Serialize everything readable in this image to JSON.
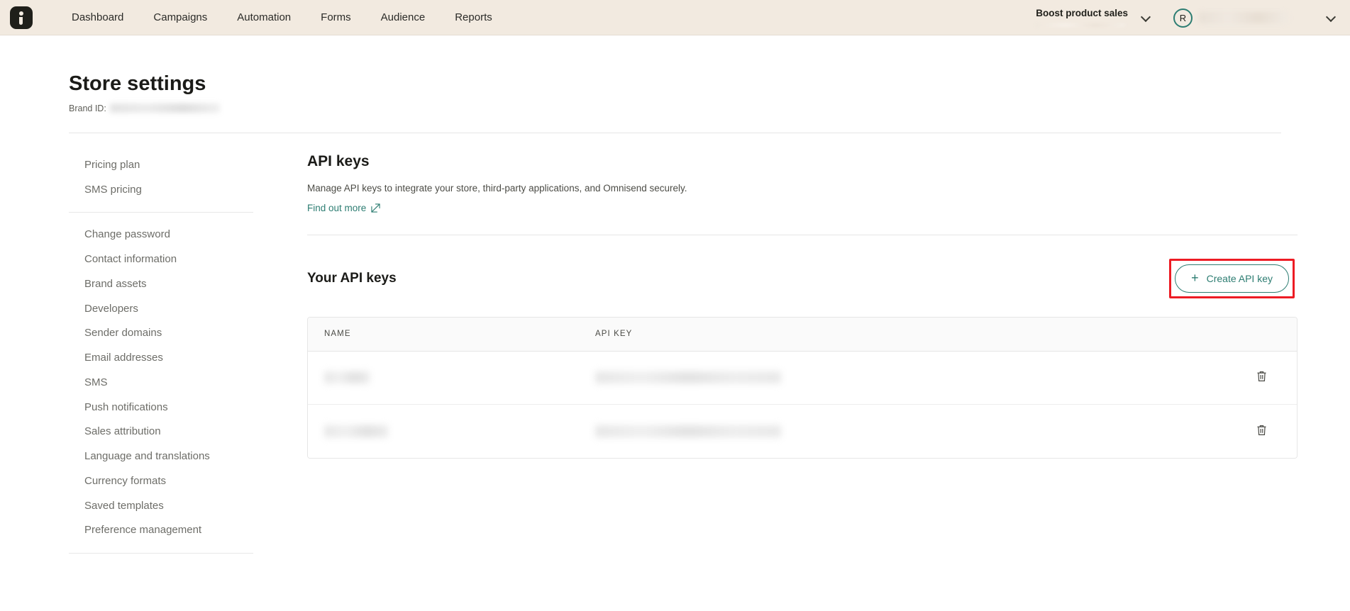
{
  "navbar": {
    "logo_icon": "omnisend-logo-icon",
    "links": [
      {
        "label": "Dashboard"
      },
      {
        "label": "Campaigns"
      },
      {
        "label": "Automation"
      },
      {
        "label": "Forms"
      },
      {
        "label": "Audience"
      },
      {
        "label": "Reports"
      }
    ],
    "boost": {
      "label": "Boost product sales",
      "progress_hidden": true,
      "chevron_icon": "chevron-down-icon"
    },
    "account": {
      "avatar_initial": "R",
      "avatar_ring_color": "#2D7D72",
      "name_hidden": true,
      "chevron_icon": "chevron-down-icon"
    },
    "background_color": "#F2EAE0"
  },
  "page": {
    "title": "Store settings",
    "brand_id_label": "Brand ID:",
    "brand_id_value_hidden": true
  },
  "sidebar": {
    "groups": [
      {
        "items": [
          {
            "label": "Pricing plan"
          },
          {
            "label": "SMS pricing"
          }
        ]
      },
      {
        "items": [
          {
            "label": "Change password"
          },
          {
            "label": "Contact information"
          },
          {
            "label": "Brand assets"
          },
          {
            "label": "Developers"
          },
          {
            "label": "Sender domains"
          },
          {
            "label": "Email addresses"
          },
          {
            "label": "SMS"
          },
          {
            "label": "Push notifications"
          },
          {
            "label": "Sales attribution"
          },
          {
            "label": "Language and translations"
          },
          {
            "label": "Currency formats"
          },
          {
            "label": "Saved templates"
          },
          {
            "label": "Preference management"
          }
        ]
      }
    ]
  },
  "main": {
    "heading": "API keys",
    "description": "Manage API keys to integrate your store, third-party applications, and Omnisend securely.",
    "find_out_more": {
      "label": "Find out more",
      "icon": "external-link-icon",
      "color": "#2D7D72"
    },
    "keys_section": {
      "title": "Your API keys",
      "create_button": {
        "label": "Create API key",
        "icon": "plus-icon",
        "border_color": "#2D7D72",
        "highlight_color": "#ED1C24",
        "highlighted": true
      },
      "table": {
        "columns": [
          {
            "key": "name",
            "label": "NAME"
          },
          {
            "key": "api_key",
            "label": "API KEY"
          },
          {
            "key": "actions",
            "label": ""
          }
        ],
        "rows": [
          {
            "name_hidden": true,
            "name_blur_width": 64,
            "api_key_hidden": true,
            "api_key_blur_width": 262,
            "delete_icon": "trash-icon"
          },
          {
            "name_hidden": true,
            "name_blur_width": 90,
            "api_key_hidden": true,
            "api_key_blur_width": 262,
            "delete_icon": "trash-icon"
          }
        ]
      }
    }
  }
}
